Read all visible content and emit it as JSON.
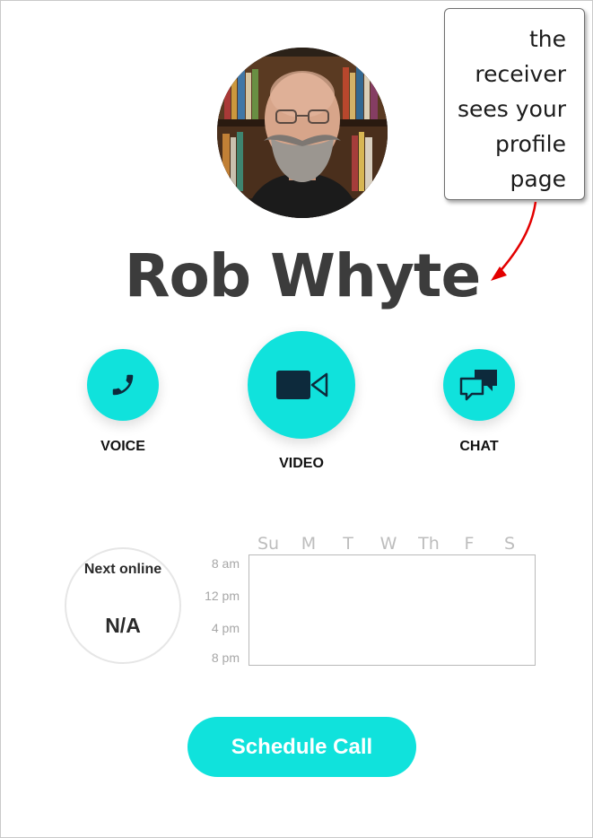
{
  "profile": {
    "name": "Rob Whyte"
  },
  "callout": {
    "lines": [
      "the",
      "receiver",
      "sees your",
      "profile",
      "page"
    ]
  },
  "actions": {
    "voice": {
      "label": "VOICE",
      "icon": "phone-icon"
    },
    "video": {
      "label": "VIDEO",
      "icon": "video-camera-icon"
    },
    "chat": {
      "label": "CHAT",
      "icon": "chat-bubbles-icon"
    }
  },
  "next_online": {
    "title": "Next online",
    "value": "N/A"
  },
  "schedule": {
    "days": [
      "Su",
      "M",
      "T",
      "W",
      "Th",
      "F",
      "S"
    ],
    "times": [
      "8 am",
      "12 pm",
      "4 pm",
      "8 pm"
    ]
  },
  "schedule_button": {
    "label": "Schedule Call"
  },
  "colors": {
    "accent": "#10e2dc",
    "icon_dark": "#0d2a3c",
    "name_text": "#3c3c3c",
    "arrow": "#e30000"
  }
}
